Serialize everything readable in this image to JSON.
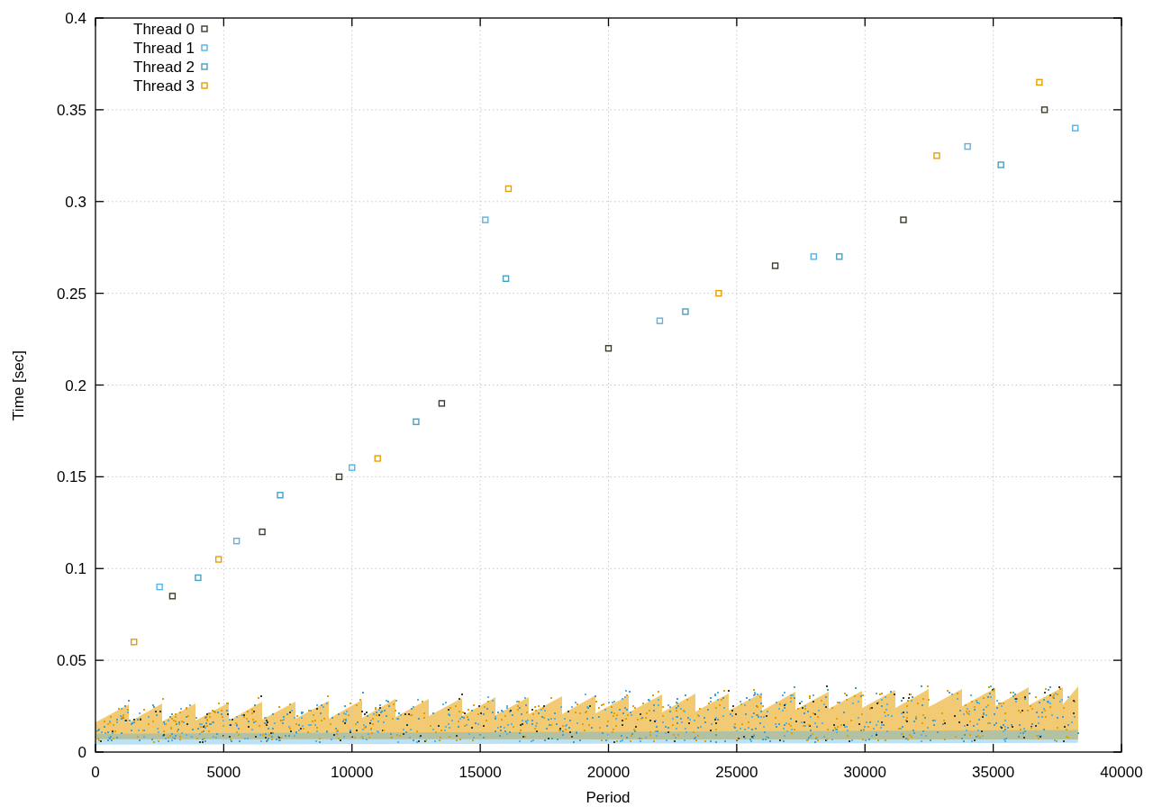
{
  "chart_data": {
    "type": "scatter",
    "grid": true,
    "legend": "top-left",
    "xlabel": "Period",
    "ylabel": "Time [sec]",
    "xlim": [
      0,
      40000
    ],
    "ylim": [
      0,
      0.4
    ],
    "xticks": [
      {
        "value": 0,
        "label": "0"
      },
      {
        "value": 5000,
        "label": "5000"
      },
      {
        "value": 10000,
        "label": "10000"
      },
      {
        "value": 15000,
        "label": "15000"
      },
      {
        "value": 20000,
        "label": "20000"
      },
      {
        "value": 25000,
        "label": "25000"
      },
      {
        "value": 30000,
        "label": "30000"
      },
      {
        "value": 35000,
        "label": "35000"
      },
      {
        "value": 40000,
        "label": "40000"
      }
    ],
    "yticks": [
      {
        "value": 0,
        "label": "0"
      },
      {
        "value": 0.05,
        "label": "0.05"
      },
      {
        "value": 0.1,
        "label": "0.1"
      },
      {
        "value": 0.15,
        "label": "0.15"
      },
      {
        "value": 0.2,
        "label": "0.2"
      },
      {
        "value": 0.25,
        "label": "0.25"
      },
      {
        "value": 0.3,
        "label": "0.3"
      },
      {
        "value": 0.35,
        "label": "0.35"
      },
      {
        "value": 0.4,
        "label": "0.4"
      }
    ],
    "series": [
      {
        "name": "Thread 0",
        "color": "#3d3d2e",
        "x": [
          3000,
          6500,
          9500,
          13500,
          20000,
          26500,
          31500,
          37000
        ],
        "values": [
          0.085,
          0.12,
          0.15,
          0.19,
          0.22,
          0.265,
          0.29,
          0.35
        ]
      },
      {
        "name": "Thread 1",
        "color": "#56b4e9",
        "x": [
          2500,
          5500,
          10000,
          15200,
          22000,
          28000,
          34000,
          38200
        ],
        "values": [
          0.09,
          0.115,
          0.155,
          0.29,
          0.235,
          0.27,
          0.33,
          0.34
        ]
      },
      {
        "name": "Thread 2",
        "color": "#4a9fc0",
        "x": [
          4000,
          7200,
          12500,
          16000,
          23000,
          29000,
          35300
        ],
        "values": [
          0.095,
          0.14,
          0.18,
          0.258,
          0.24,
          0.27,
          0.32
        ]
      },
      {
        "name": "Thread 3",
        "color": "#e69f00",
        "x": [
          1500,
          4800,
          11000,
          16100,
          24300,
          32800,
          36800
        ],
        "values": [
          0.06,
          0.105,
          0.16,
          0.307,
          0.25,
          0.325,
          0.365
        ]
      }
    ]
  }
}
